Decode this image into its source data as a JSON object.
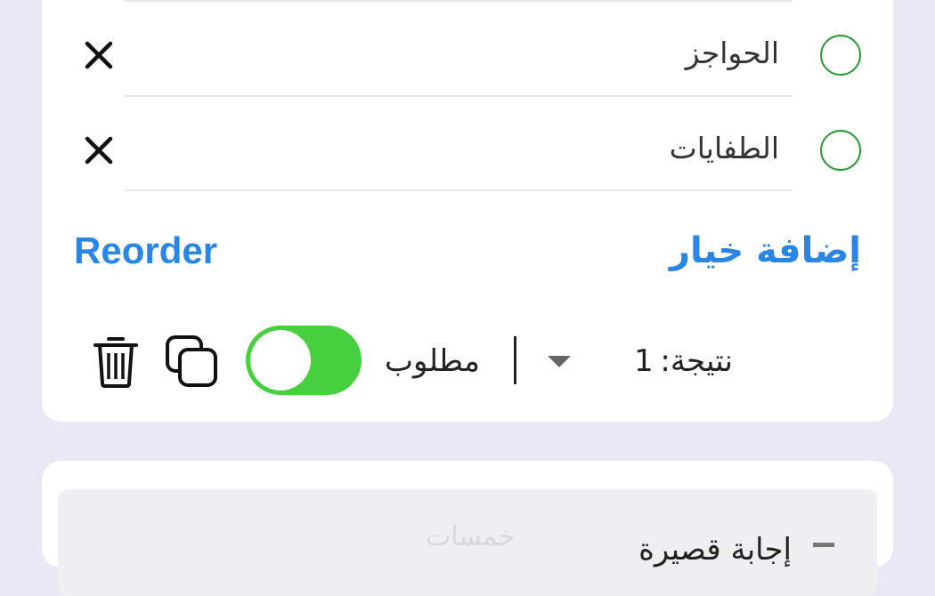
{
  "question": {
    "options": [
      {
        "label": "الحواجز"
      },
      {
        "label": "الطفايات"
      }
    ],
    "add_option_label": "إضافة خيار",
    "reorder_label": "Reorder",
    "score_label": "نتيجة:",
    "score_value": "1",
    "required_label": "مطلوب",
    "required_enabled": true
  },
  "next_question": {
    "type_label": "إجابة قصيرة",
    "watermark": "خمسات"
  },
  "colors": {
    "accent": "#2a86e6",
    "radio_border": "#2e9a35",
    "toggle_on": "#46d03f",
    "background": "#ebe8f6"
  },
  "icons": [
    "radio-circle-icon",
    "close-icon",
    "chevron-down-icon",
    "copy-icon",
    "trash-icon",
    "minus-icon"
  ]
}
